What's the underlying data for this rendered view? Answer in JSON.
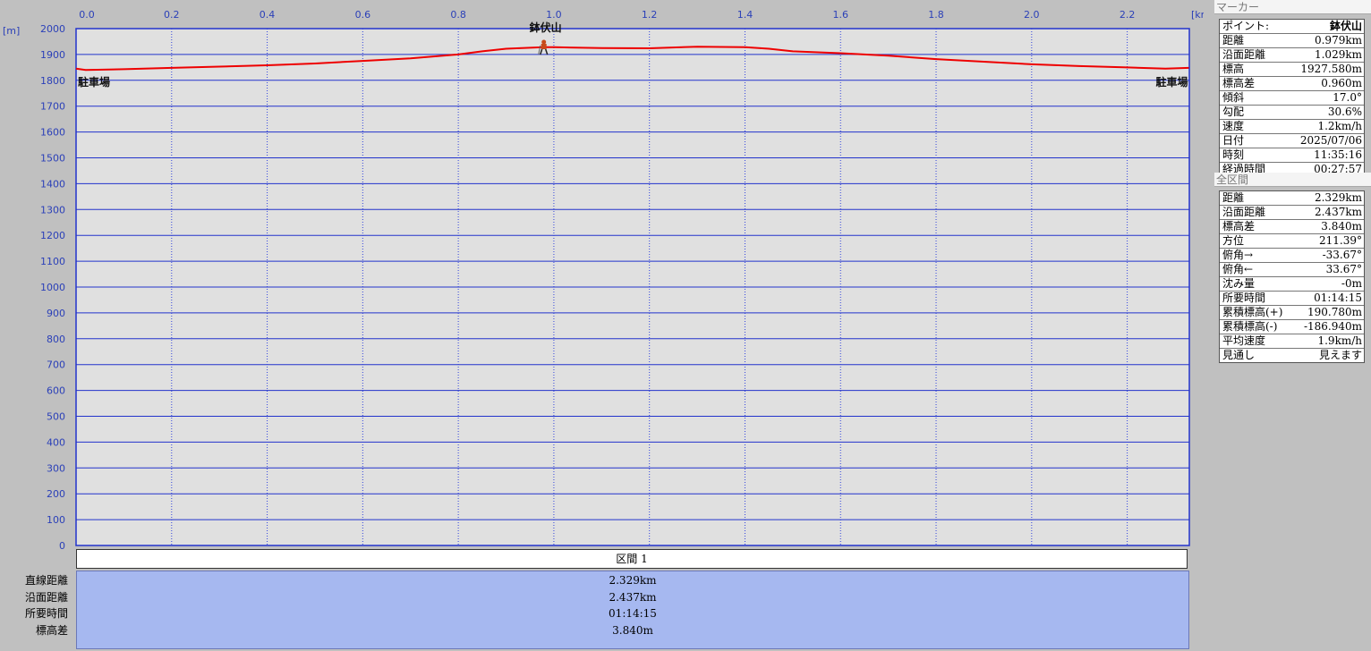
{
  "chart": {
    "y_unit": "[m]",
    "x_unit": "[km]",
    "y_ticks": [
      "2000",
      "1900",
      "1800",
      "1700",
      "1600",
      "1500",
      "1400",
      "1300",
      "1200",
      "1100",
      "1000",
      "900",
      "800",
      "700",
      "600",
      "500",
      "400",
      "300",
      "200",
      "100",
      "0"
    ],
    "x_ticks": [
      "0.0",
      "0.2",
      "0.4",
      "0.6",
      "0.8",
      "1.0",
      "1.2",
      "1.4",
      "1.6",
      "1.8",
      "2.0",
      "2.2"
    ],
    "labels": {
      "start": "駐車場",
      "summit": "鉢伏山",
      "end": "駐車場"
    },
    "colors": {
      "line": "#ee0000",
      "grid": "#2233cc",
      "background": "#e0e0e0"
    }
  },
  "chart_data": {
    "type": "line",
    "xlabel": "[km]",
    "ylabel": "[m]",
    "xlim": [
      0,
      2.33
    ],
    "ylim": [
      0,
      2000
    ],
    "grid": true,
    "series": [
      {
        "x": [
          0.0,
          0.02,
          0.1,
          0.2,
          0.3,
          0.4,
          0.5,
          0.6,
          0.7,
          0.8,
          0.85,
          0.9,
          0.95,
          0.979,
          1.0,
          1.1,
          1.2,
          1.3,
          1.4,
          1.45,
          1.5,
          1.6,
          1.7,
          1.8,
          1.9,
          2.0,
          2.1,
          2.2,
          2.28,
          2.329
        ],
        "y": [
          1845,
          1840,
          1843,
          1848,
          1853,
          1858,
          1865,
          1875,
          1885,
          1900,
          1912,
          1922,
          1926,
          1928,
          1928,
          1925,
          1924,
          1930,
          1928,
          1922,
          1912,
          1905,
          1895,
          1882,
          1872,
          1862,
          1855,
          1850,
          1845,
          1848
        ]
      }
    ],
    "markers": [
      {
        "x": 0.0,
        "label": "駐車場"
      },
      {
        "x": 0.979,
        "label": "鉢伏山"
      },
      {
        "x": 2.329,
        "label": "駐車場"
      }
    ]
  },
  "section": {
    "header": "区間 1",
    "rows": [
      {
        "label": "直線距離",
        "value": "2.329km"
      },
      {
        "label": "沿面距離",
        "value": "2.437km"
      },
      {
        "label": "所要時間",
        "value": "01:14:15"
      },
      {
        "label": "標高差",
        "value": "3.840m"
      }
    ]
  },
  "marker_panel": {
    "title": "マーカー",
    "rows": [
      {
        "key": "ポイント:",
        "value": "鉢伏山"
      },
      {
        "key": "距離",
        "value": "0.979km"
      },
      {
        "key": "沿面距離",
        "value": "1.029km"
      },
      {
        "key": "標高",
        "value": "1927.580m"
      },
      {
        "key": "標高差",
        "value": "0.960m"
      },
      {
        "key": "傾斜",
        "value": "17.0°"
      },
      {
        "key": "勾配",
        "value": "30.6%"
      },
      {
        "key": "速度",
        "value": "1.2km/h"
      },
      {
        "key": "日付",
        "value": "2025/07/06"
      },
      {
        "key": "時刻",
        "value": "11:35:16"
      },
      {
        "key": "経過時間",
        "value": "00:27:57"
      }
    ]
  },
  "all_panel": {
    "title": "全区間",
    "rows": [
      {
        "key": "距離",
        "value": "2.329km"
      },
      {
        "key": "沿面距離",
        "value": "2.437km"
      },
      {
        "key": "標高差",
        "value": "3.840m"
      },
      {
        "key": "方位",
        "value": "211.39°"
      },
      {
        "key": "俯角→",
        "value": "-33.67°"
      },
      {
        "key": "俯角←",
        "value": "33.67°"
      },
      {
        "key": "沈み量",
        "value": "-0m"
      },
      {
        "key": "所要時間",
        "value": "01:14:15"
      },
      {
        "key": "累積標高(+)",
        "value": "190.780m"
      },
      {
        "key": "累積標高(-)",
        "value": "-186.940m"
      },
      {
        "key": "平均速度",
        "value": "1.9km/h"
      },
      {
        "key": "見通し",
        "value": "見えます"
      }
    ]
  }
}
